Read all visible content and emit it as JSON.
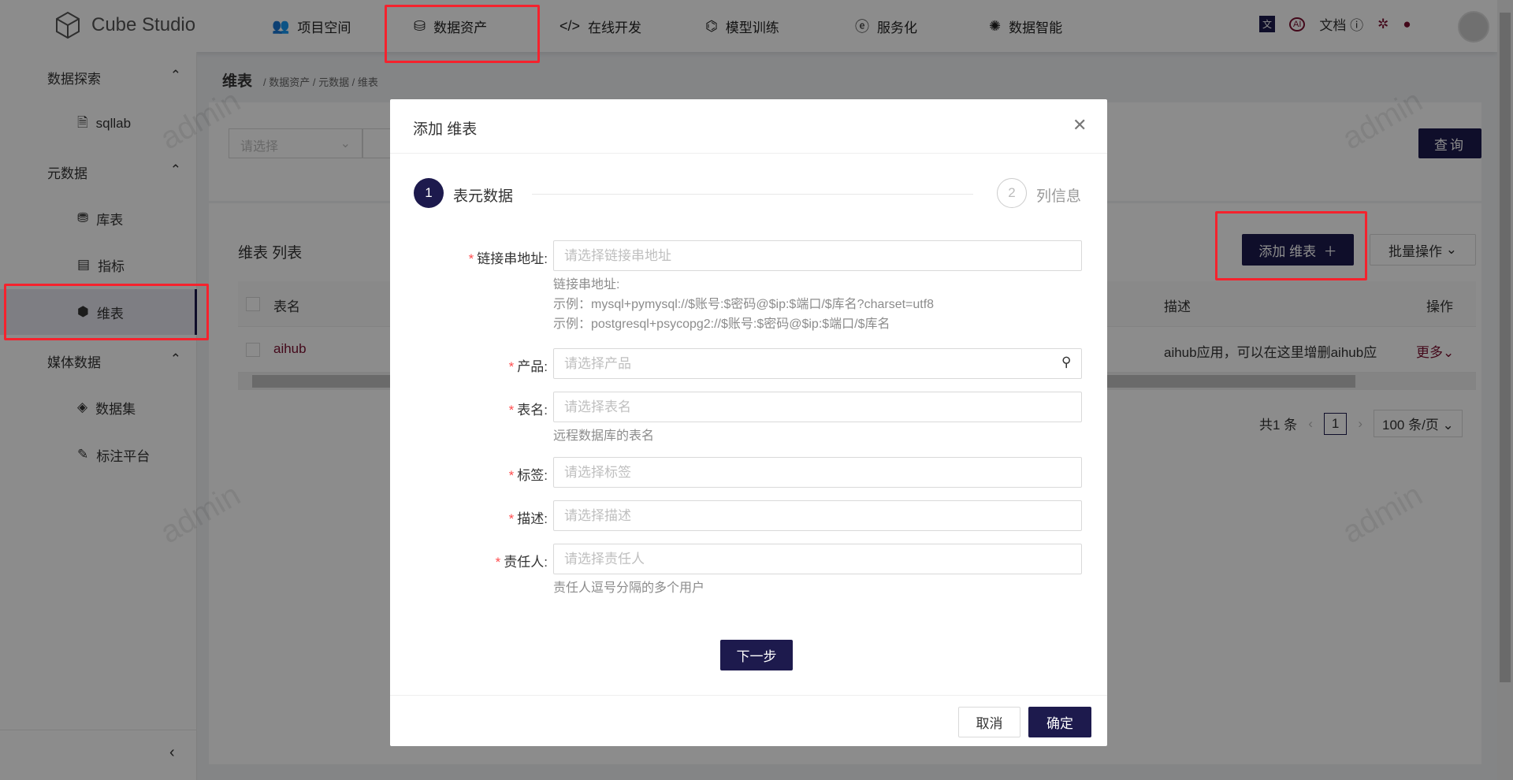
{
  "app": {
    "name": "Cube Studio"
  },
  "nav": [
    {
      "label": "项目空间",
      "icon": "team-icon"
    },
    {
      "label": "数据资产",
      "icon": "database-icon"
    },
    {
      "label": "在线开发",
      "icon": "code-icon"
    },
    {
      "label": "模型训练",
      "icon": "training-icon"
    },
    {
      "label": "服务化",
      "icon": "service-icon"
    },
    {
      "label": "数据智能",
      "icon": "ai-icon"
    }
  ],
  "header_right": {
    "docs": "文档"
  },
  "sidebar": {
    "groups": [
      {
        "label": "数据探索",
        "items": [
          {
            "label": "sqllab"
          }
        ]
      },
      {
        "label": "元数据",
        "items": [
          {
            "label": "库表"
          },
          {
            "label": "指标"
          },
          {
            "label": "维表",
            "selected": true
          }
        ]
      },
      {
        "label": "媒体数据",
        "items": [
          {
            "label": "数据集"
          },
          {
            "label": "标注平台"
          }
        ]
      }
    ]
  },
  "breadcrumb": {
    "title": "维表",
    "path": "/ 数据资产 / 元数据 / 维表"
  },
  "filter": {
    "select_placeholder": "请选择",
    "query": "查询"
  },
  "list": {
    "title": "维表 列表",
    "add": "添加 维表",
    "batch": "批量操作",
    "columns": [
      "表名",
      "描述",
      "操作"
    ],
    "rows": [
      {
        "name": "aihub",
        "desc": "aihub应用，可以在这里增删aihub应",
        "action": "更多"
      }
    ],
    "pagination": {
      "total": "共1 条",
      "page": "1",
      "size": "100 条/页"
    }
  },
  "modal": {
    "title": "添加 维表",
    "steps": [
      {
        "num": "1",
        "label": "表元数据",
        "active": true
      },
      {
        "num": "2",
        "label": "列信息",
        "active": false
      }
    ],
    "fields": [
      {
        "label": "链接串地址:",
        "placeholder": "请选择链接串地址",
        "help": [
          "链接串地址:",
          "示例：mysql+pymysql://$账号:$密码@$ip:$端口/$库名?charset=utf8",
          "示例：postgresql+psycopg2://$账号:$密码@$ip:$端口/$库名"
        ]
      },
      {
        "label": "产品:",
        "placeholder": "请选择产品"
      },
      {
        "label": "表名:",
        "placeholder": "请选择表名",
        "help": [
          "远程数据库的表名"
        ]
      },
      {
        "label": "标签:",
        "placeholder": "请选择标签"
      },
      {
        "label": "描述:",
        "placeholder": "请选择描述"
      },
      {
        "label": "责任人:",
        "placeholder": "请选择责任人",
        "help": [
          "责任人逗号分隔的多个用户"
        ]
      }
    ],
    "next": "下一步",
    "cancel": "取消",
    "ok": "确定"
  },
  "watermark": "admin",
  "colors": {
    "primary": "#1d1a4d",
    "highlight": "#f5222d"
  }
}
